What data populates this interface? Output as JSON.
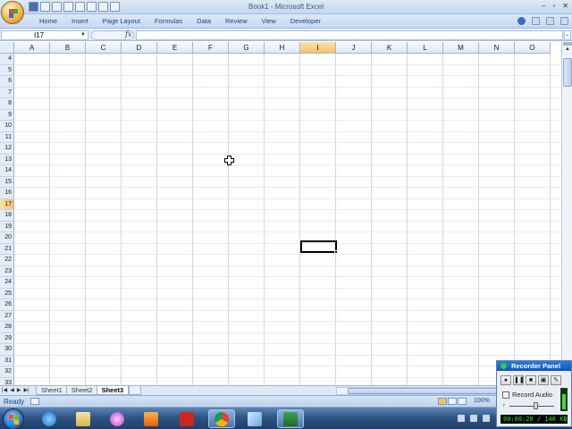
{
  "app": {
    "title": "Book1 - Microsoft Excel",
    "window_controls": [
      "–",
      "▫",
      "✕"
    ]
  },
  "ribbon": {
    "tabs": [
      "Home",
      "Insert",
      "Page Layout",
      "Formulas",
      "Data",
      "Review",
      "View",
      "Developer"
    ]
  },
  "formula_bar": {
    "name_box": "I17",
    "fx": "fx",
    "value": ""
  },
  "grid": {
    "columns": [
      "A",
      "B",
      "C",
      "D",
      "E",
      "F",
      "G",
      "H",
      "I",
      "J",
      "K",
      "L",
      "M",
      "N",
      "O"
    ],
    "rows": [
      "4",
      "5",
      "6",
      "7",
      "8",
      "9",
      "10",
      "11",
      "12",
      "13",
      "14",
      "15",
      "16",
      "17",
      "18",
      "19",
      "20",
      "21",
      "22",
      "23",
      "24",
      "25",
      "26",
      "27",
      "28",
      "29",
      "30",
      "31",
      "32",
      "33"
    ],
    "selected_column": "I",
    "selected_row": "17"
  },
  "sheets": {
    "tabs": [
      "Sheet1",
      "Sheet2",
      "Sheet3"
    ],
    "active": "Sheet3"
  },
  "status": {
    "text": "Ready",
    "zoom": "100%"
  },
  "taskbar": {
    "apps": [
      "internet-explorer",
      "file-explorer",
      "media-center",
      "media-player",
      "cf-app",
      "chrome",
      "notepad-app",
      "excel"
    ]
  },
  "recorder": {
    "title": "Recorder Panel",
    "record_audio_label": "Record Audio",
    "record_audio_checked": false,
    "volume_level": 0.6,
    "status": "00:00:20 / 146 KB"
  },
  "colors": {
    "accent": "#15428b",
    "selection_header": "#f5c26b",
    "taskbar": "#2f5583",
    "recorder_title": "#0f55b6",
    "recorder_status_text": "#38e838"
  }
}
